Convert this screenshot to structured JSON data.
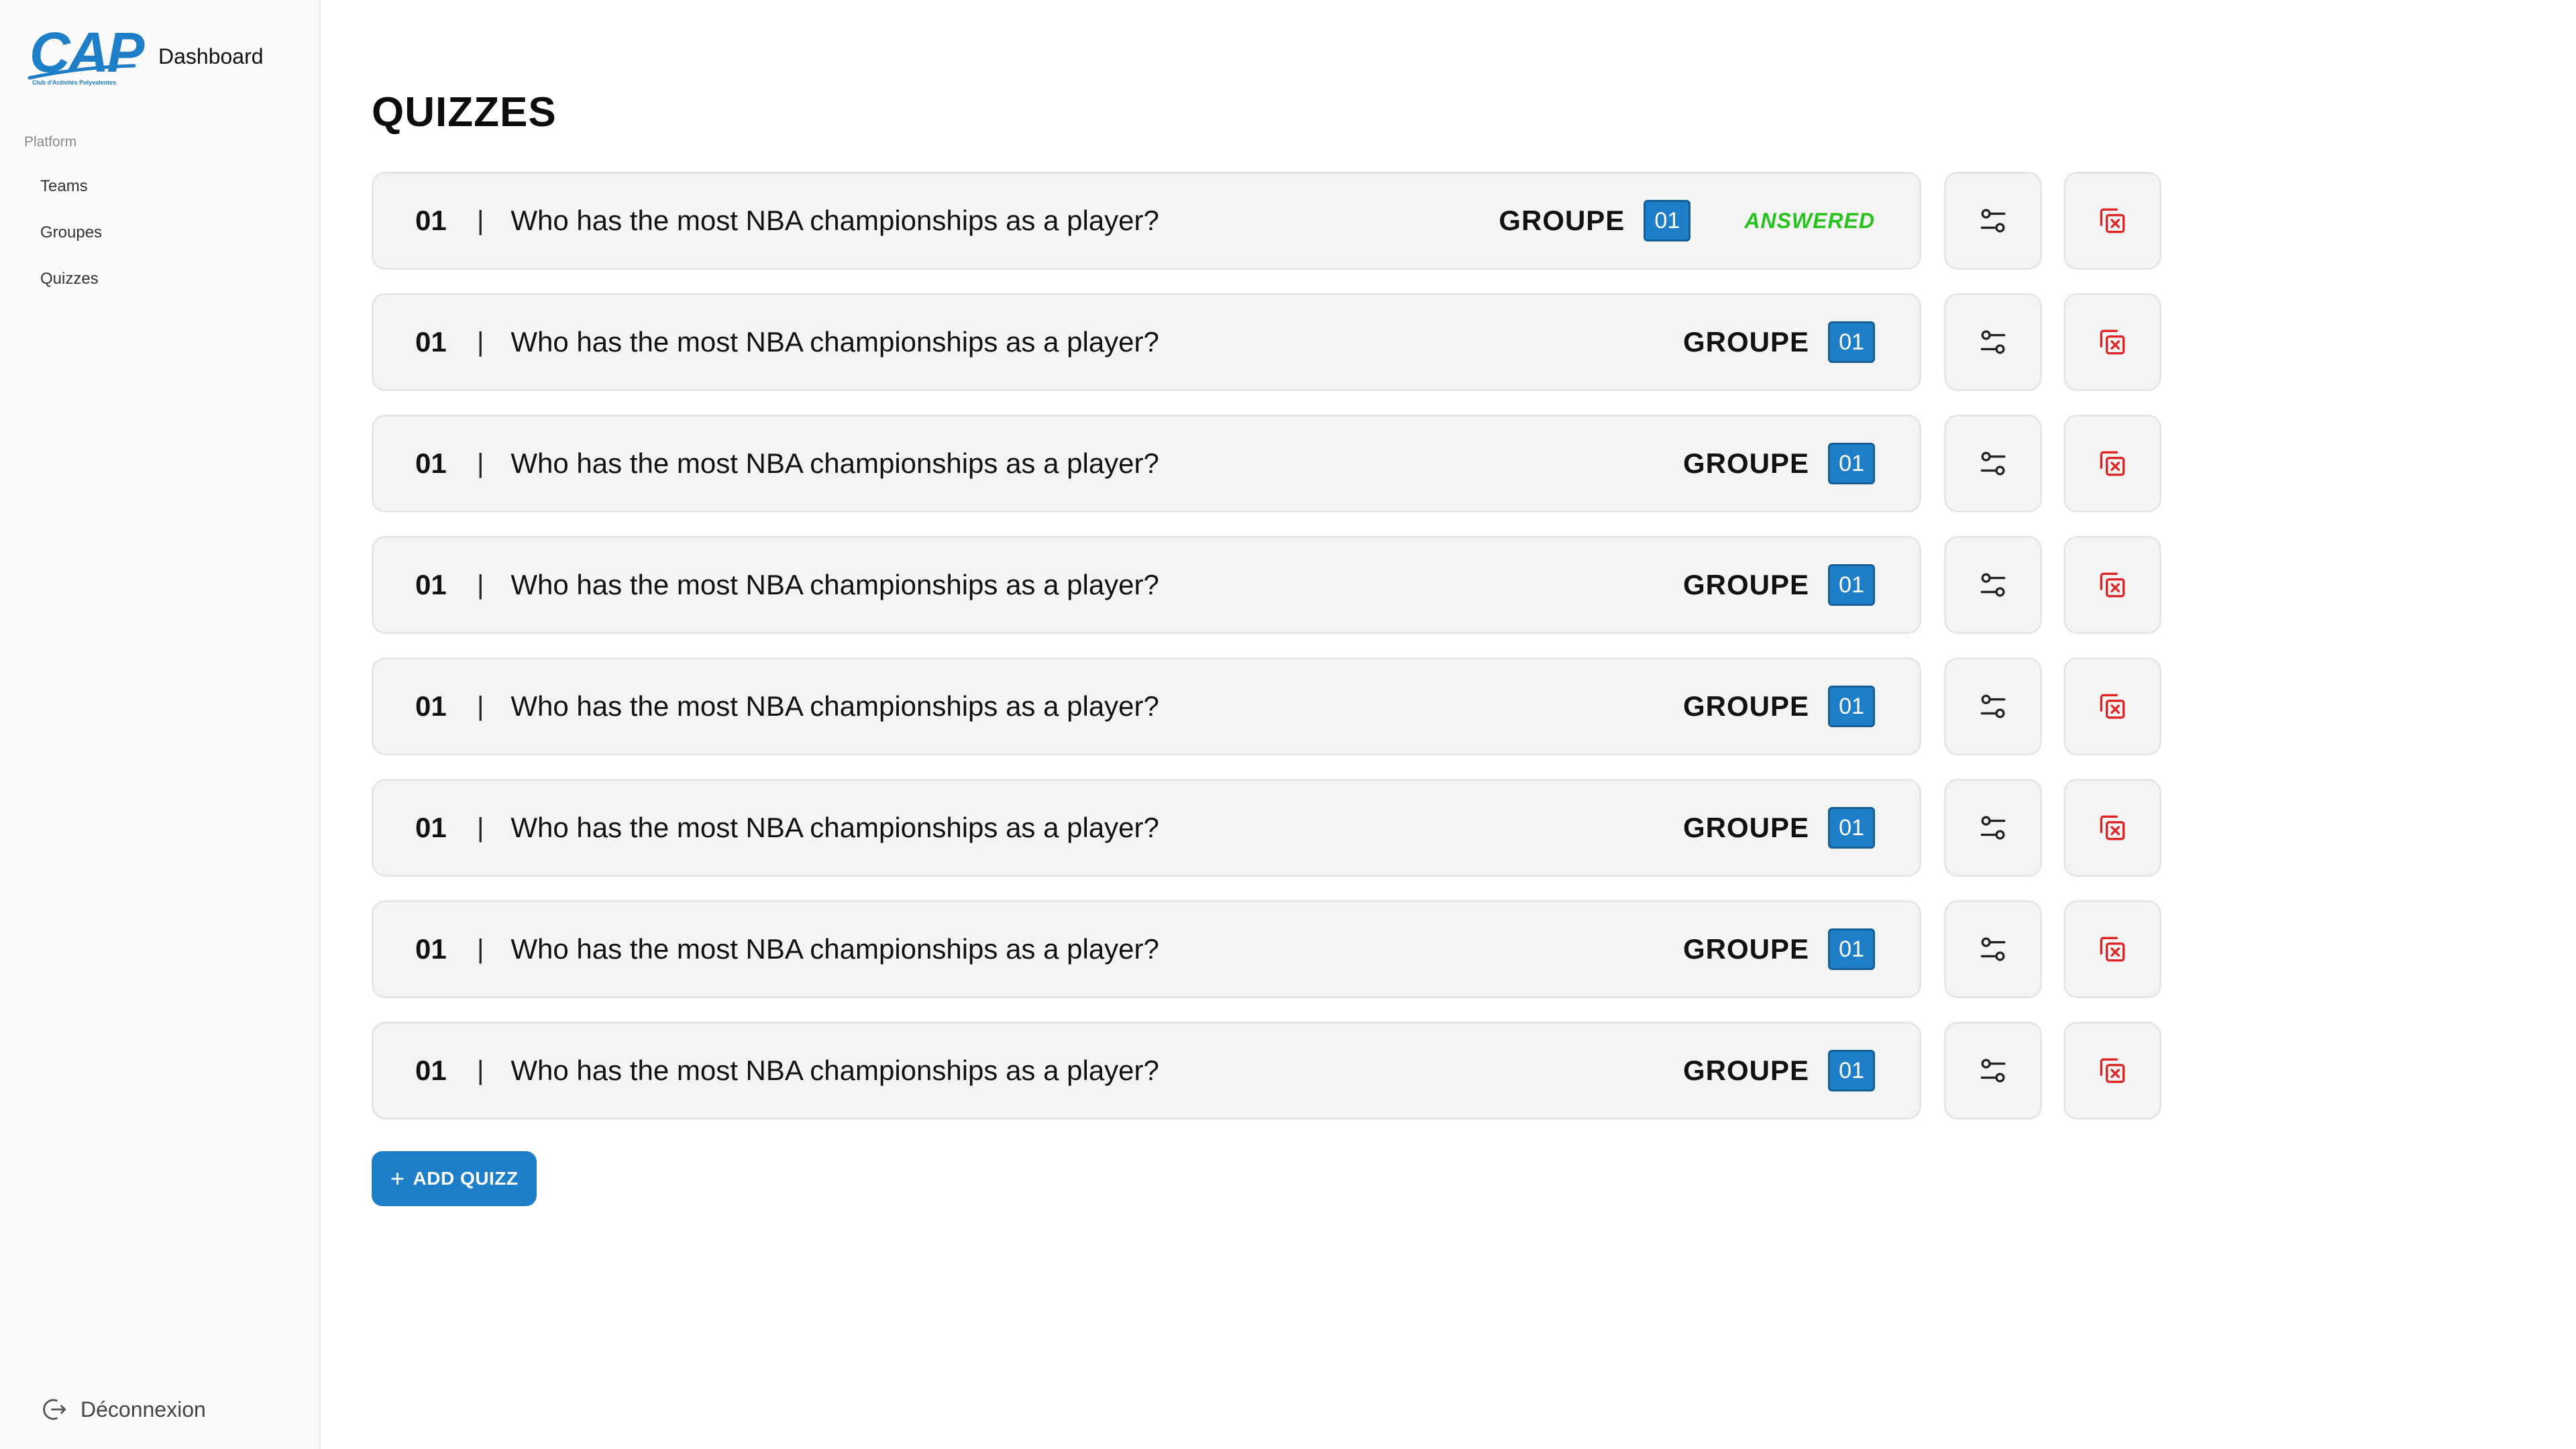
{
  "brand": {
    "logo_text": "CAP",
    "logo_subtitle": "Club d'Activités Polyvalentes",
    "title": "Dashboard",
    "accent_color": "#1e7ec8"
  },
  "sidebar": {
    "section_label": "Platform",
    "items": [
      {
        "label": "Teams"
      },
      {
        "label": "Groupes"
      },
      {
        "label": "Quizzes"
      }
    ],
    "logout_label": "Déconnexion",
    "logout_icon": "logout-icon"
  },
  "main": {
    "title": "QUIZZES",
    "quizzes": [
      {
        "number": "01",
        "separator": "|",
        "question": "Who has the most NBA championships as a player?",
        "group_label": "GROUPE",
        "group_number": "01",
        "status": "ANSWERED"
      },
      {
        "number": "01",
        "separator": "|",
        "question": "Who has the most NBA championships as a player?",
        "group_label": "GROUPE",
        "group_number": "01",
        "status": ""
      },
      {
        "number": "01",
        "separator": "|",
        "question": "Who has the most NBA championships as a player?",
        "group_label": "GROUPE",
        "group_number": "01",
        "status": ""
      },
      {
        "number": "01",
        "separator": "|",
        "question": "Who has the most NBA championships as a player?",
        "group_label": "GROUPE",
        "group_number": "01",
        "status": ""
      },
      {
        "number": "01",
        "separator": "|",
        "question": "Who has the most NBA championships as a player?",
        "group_label": "GROUPE",
        "group_number": "01",
        "status": ""
      },
      {
        "number": "01",
        "separator": "|",
        "question": "Who has the most NBA championships as a player?",
        "group_label": "GROUPE",
        "group_number": "01",
        "status": ""
      },
      {
        "number": "01",
        "separator": "|",
        "question": "Who has the most NBA championships as a player?",
        "group_label": "GROUPE",
        "group_number": "01",
        "status": ""
      },
      {
        "number": "01",
        "separator": "|",
        "question": "Who has the most NBA championships as a player?",
        "group_label": "GROUPE",
        "group_number": "01",
        "status": ""
      }
    ],
    "settings_icon": "sliders-icon",
    "delete_icon": "delete-copy-icon",
    "add_button_label": "ADD QUIZZ",
    "add_button_icon": "+",
    "status_color": "#27c21e",
    "delete_color": "#e02424"
  }
}
